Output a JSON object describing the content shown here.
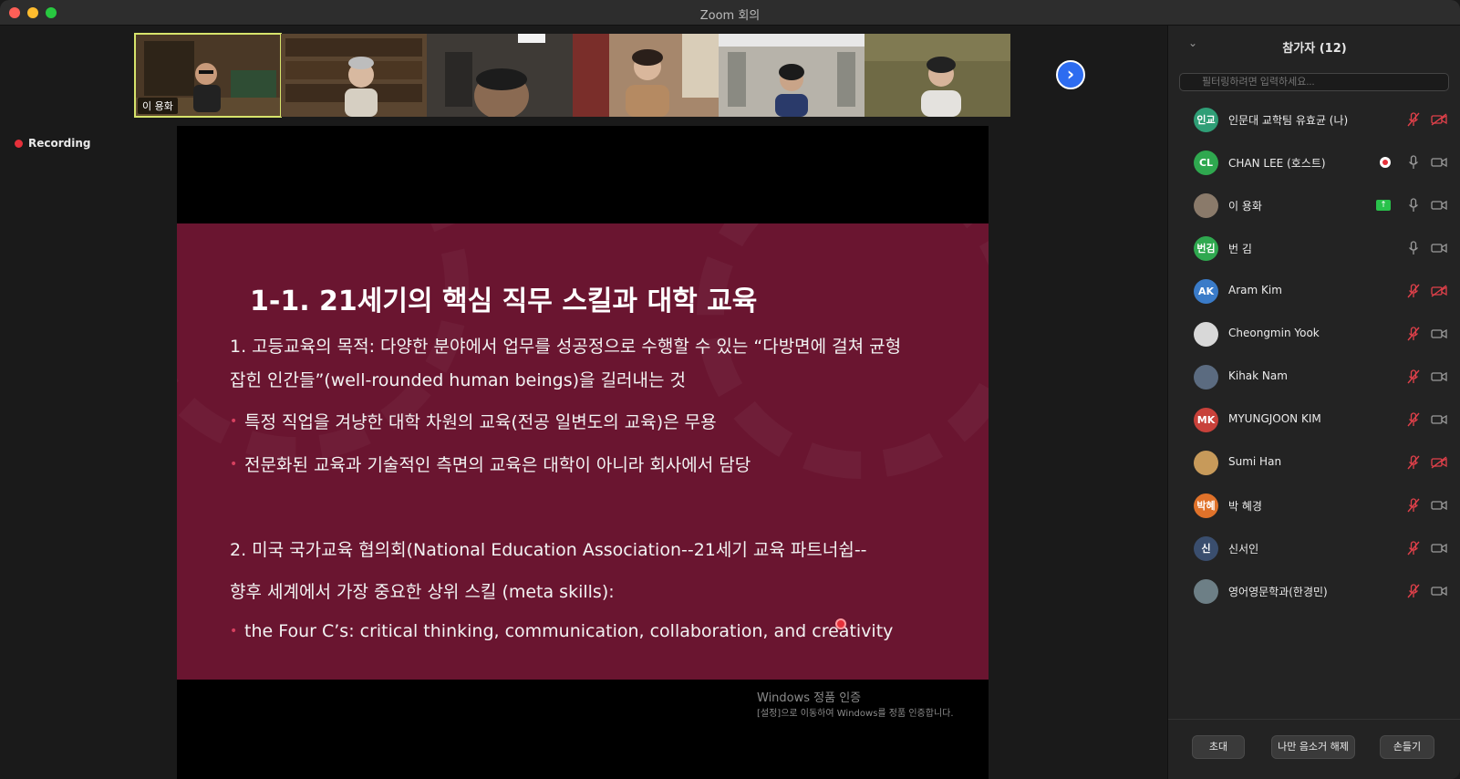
{
  "window": {
    "title": "Zoom 회의"
  },
  "recording": {
    "label": "Recording"
  },
  "thumbnails": [
    {
      "name": "이 용화",
      "bg": "#4a3826"
    },
    {
      "name": "",
      "bg": "#5a4530"
    },
    {
      "name": "",
      "bg": "#3e3a36"
    },
    {
      "name": "",
      "bg": "#8a6b55"
    },
    {
      "name": "",
      "bg": "#9a9a92"
    },
    {
      "name": "",
      "bg": "#6f6a45"
    }
  ],
  "slide": {
    "title": "1-1. 21세기의 핵심 직무 스킬과 대학 교육",
    "line1": "1. 고등교육의 목적: 다양한 분야에서 업무를 성공정으로 수행할 수 있는 “다방면에 걸쳐 균형",
    "line2": "잡힌 인간들”(well-rounded human beings)을 길러내는 것",
    "bullet1": "특정 직업을 겨냥한 대학 차원의 교육(전공 일변도의 교육)은 무용",
    "bullet2": "전문화된 교육과 기술적인 측면의 교육은 대학이 아니라 회사에서 담당",
    "line3": "2. 미국 국가교육 협의회(National Education Association--21세기 교육 파트너쉽--",
    "line4": " 향후 세계에서 가장 중요한 상위 스킬 (meta skills):",
    "bullet3": "the Four C’s: critical thinking, communication, collaboration, and creativity"
  },
  "watermark": {
    "title": "Windows 정품 인증",
    "sub": "[설정]으로 이동하여 Windows를 정품 인증합니다."
  },
  "panel": {
    "title": "참가자 (12)",
    "search_placeholder": "필터링하려면 입력하세요...",
    "participants": [
      {
        "initials": "인교",
        "color": "#2f9e76",
        "name": "인문대 교학팀 유효균 (나)",
        "mic": "off",
        "cam": "off"
      },
      {
        "initials": "CL",
        "color": "#2fa84f",
        "name": "CHAN LEE (호스트)",
        "mic": "on",
        "cam": "on",
        "badge": "rec"
      },
      {
        "initials": "",
        "color": "#8a7a6a",
        "name": "이 용화",
        "mic": "on",
        "cam": "on",
        "badge": "share"
      },
      {
        "initials": "번김",
        "color": "#2fa84f",
        "name": "번 김",
        "mic": "on",
        "cam": "on"
      },
      {
        "initials": "AK",
        "color": "#3a7bc8",
        "name": "Aram Kim",
        "mic": "off",
        "cam": "off"
      },
      {
        "initials": "",
        "color": "#d8d8d8",
        "name": "Cheongmin Yook",
        "mic": "off",
        "cam": "on"
      },
      {
        "initials": "",
        "color": "#5b6b80",
        "name": "Kihak Nam",
        "mic": "off",
        "cam": "on"
      },
      {
        "initials": "MK",
        "color": "#c8413a",
        "name": "MYUNGJOON KIM",
        "mic": "off",
        "cam": "on"
      },
      {
        "initials": "",
        "color": "#c79a5a",
        "name": "Sumi Han",
        "mic": "off",
        "cam": "off"
      },
      {
        "initials": "박혜",
        "color": "#e0722a",
        "name": "박 혜경",
        "mic": "off",
        "cam": "on"
      },
      {
        "initials": "신",
        "color": "#3a4e6e",
        "name": "신서인",
        "mic": "off",
        "cam": "on"
      },
      {
        "initials": "",
        "color": "#6d7f86",
        "name": "영어영문학과(한경민)",
        "mic": "off",
        "cam": "on"
      }
    ],
    "buttons": {
      "invite": "초대",
      "unmute": "나만 음소거 해제",
      "raise": "손들기"
    }
  }
}
